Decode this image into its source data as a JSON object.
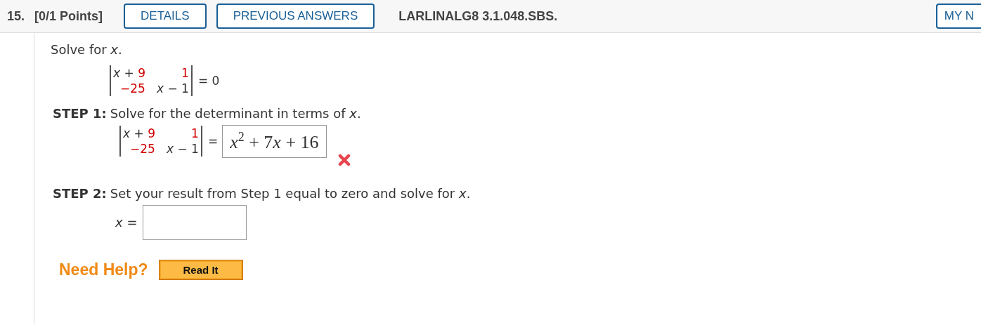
{
  "header": {
    "question_number": "15.",
    "points": "[0/1 Points]",
    "buttons": [
      {
        "label": "DETAILS"
      },
      {
        "label": "PREVIOUS ANSWERS"
      }
    ],
    "problem_code": "LARLINALG8 3.1.048.SBS.",
    "right_button": {
      "label": "MY N"
    }
  },
  "prompt": "Solve for *x*.",
  "matrix": {
    "rows": [
      [
        [
          {
            "t": "x",
            "kind": "var"
          },
          {
            "t": " + ",
            "kind": "op"
          },
          {
            "t": "9",
            "kind": "given"
          }
        ],
        [
          {
            "t": "1",
            "kind": "given"
          }
        ]
      ],
      [
        [
          {
            "t": "−25",
            "kind": "given"
          }
        ],
        [
          {
            "t": "x",
            "kind": "var"
          },
          {
            "t": " − 1",
            "kind": "op"
          }
        ]
      ]
    ],
    "rhs": "= 0"
  },
  "step1": {
    "label": "STEP 1:",
    "text": "Solve for the determinant in terms of *x*.",
    "matrix": {
      "rows": [
        [
          [
            {
              "t": "x",
              "kind": "var"
            },
            {
              "t": " + ",
              "kind": "op"
            },
            {
              "t": "9",
              "kind": "given"
            }
          ],
          [
            {
              "t": "1",
              "kind": "given"
            }
          ]
        ],
        [
          [
            {
              "t": "−25",
              "kind": "given"
            }
          ],
          [
            {
              "t": "x",
              "kind": "var"
            },
            {
              "t": " − 1",
              "kind": "op"
            }
          ]
        ]
      ]
    },
    "equals": "=",
    "answer": [
      {
        "t": "x",
        "kind": "var"
      },
      {
        "t": "2",
        "kind": "sup"
      },
      {
        "t": " + 7",
        "kind": "op"
      },
      {
        "t": "x",
        "kind": "var"
      },
      {
        "t": " + 16",
        "kind": "op"
      }
    ],
    "correct": false
  },
  "step2": {
    "label": "STEP 2:",
    "text": "Set your result from Step 1 equal to zero and solve for *x*.",
    "input_label": "*x* ="
  },
  "help": {
    "label": "Need Help?",
    "buttons": [
      {
        "label": "Read It"
      }
    ]
  }
}
